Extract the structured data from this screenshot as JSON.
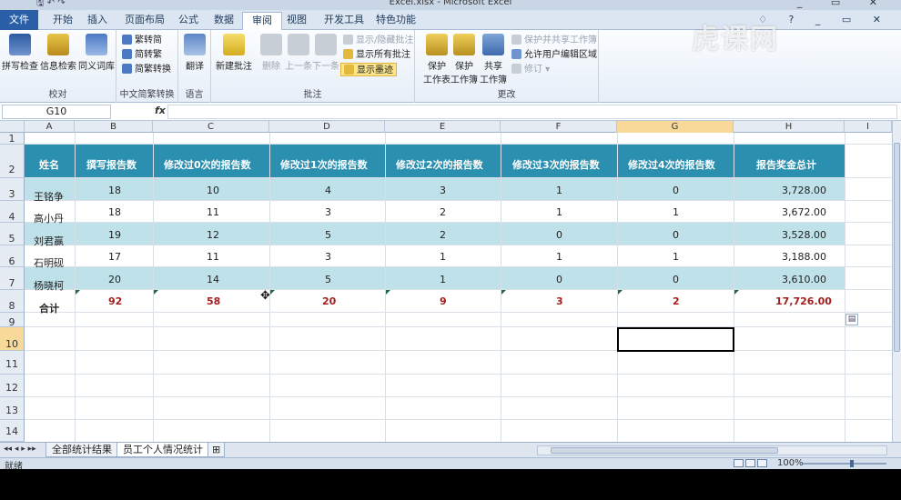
{
  "window": {
    "title": "Excel.xlsx - Microsoft Excel",
    "quick_access": "🖫 ↶ ↷",
    "controls": "_ ▭ ✕"
  },
  "tabs": [
    "文件",
    "开始",
    "插入",
    "页面布局",
    "公式",
    "数据",
    "审阅",
    "视图",
    "开发工具",
    "特色功能"
  ],
  "tab_right_icons": "♢ ? _ ▭ ✕",
  "active_tab_index": 6,
  "ribbon": {
    "proofing": {
      "label": "校对",
      "spell": "拼写检查",
      "research": "信息检索",
      "thesaurus": "同义词库"
    },
    "chinese": {
      "label": "中文简繁转换",
      "to_simp": "繁转简",
      "to_trad": "简转繁",
      "convert": "简繁转换"
    },
    "language": {
      "label": "语言",
      "translate": "翻译"
    },
    "comments": {
      "label": "批注",
      "new": "新建批注",
      "delete": "删除",
      "prev": "上一条",
      "next": "下一条",
      "show_hide": "显示/隐藏批注",
      "show_all": "显示所有批注",
      "show_ink": "显示墨迹"
    },
    "changes": {
      "label": "更改",
      "protect_sheet_1": "保护",
      "protect_sheet_2": "工作表",
      "protect_wb_1": "保护",
      "protect_wb_2": "工作簿",
      "share_wb_1": "共享",
      "share_wb_2": "工作簿",
      "protect_share": "保护并共享工作簿",
      "allow_edit": "允许用户编辑区域",
      "track": "修订 ▾"
    }
  },
  "formula_bar": {
    "name_box": "G10",
    "fx": "fx",
    "value": ""
  },
  "columns": [
    "A",
    "B",
    "C",
    "D",
    "E",
    "F",
    "G",
    "H",
    "I"
  ],
  "selected_column": "G",
  "rows": [
    "1",
    "2",
    "3",
    "4",
    "5",
    "6",
    "7",
    "8",
    "9",
    "10",
    "11",
    "12",
    "13",
    "14"
  ],
  "selected_row": "10",
  "table": {
    "headers": [
      "姓名",
      "撰写报告数",
      "修改过0次的报告数",
      "修改过1次的报告数",
      "修改过2次的报告数",
      "修改过3次的报告数",
      "修改过4次的报告数",
      "报告奖金总计"
    ],
    "rows": [
      [
        "王铭争",
        "18",
        "10",
        "4",
        "3",
        "1",
        "0",
        "3,728.00"
      ],
      [
        "高小丹",
        "18",
        "11",
        "3",
        "2",
        "1",
        "1",
        "3,672.00"
      ],
      [
        "刘君赢",
        "19",
        "12",
        "5",
        "2",
        "0",
        "0",
        "3,528.00"
      ],
      [
        "石明砚",
        "17",
        "11",
        "3",
        "1",
        "1",
        "1",
        "3,188.00"
      ],
      [
        "杨晓柯",
        "20",
        "14",
        "5",
        "1",
        "0",
        "0",
        "3,610.00"
      ]
    ],
    "total": [
      "合计",
      "92",
      "58",
      "20",
      "9",
      "3",
      "2",
      "17,726.00"
    ],
    "header_color": "#2b8fb0",
    "band_color": "#bfe1ea",
    "total_color": "#a01e1e"
  },
  "sheets": [
    "全部统计结果",
    "员工个人情况统计"
  ],
  "active_sheet_index": 1,
  "sheet_nav": "◂◂ ◂ ▸ ▸▸",
  "status": {
    "ready": "就绪",
    "zoom": "100%"
  },
  "watermark": "虎课网"
}
